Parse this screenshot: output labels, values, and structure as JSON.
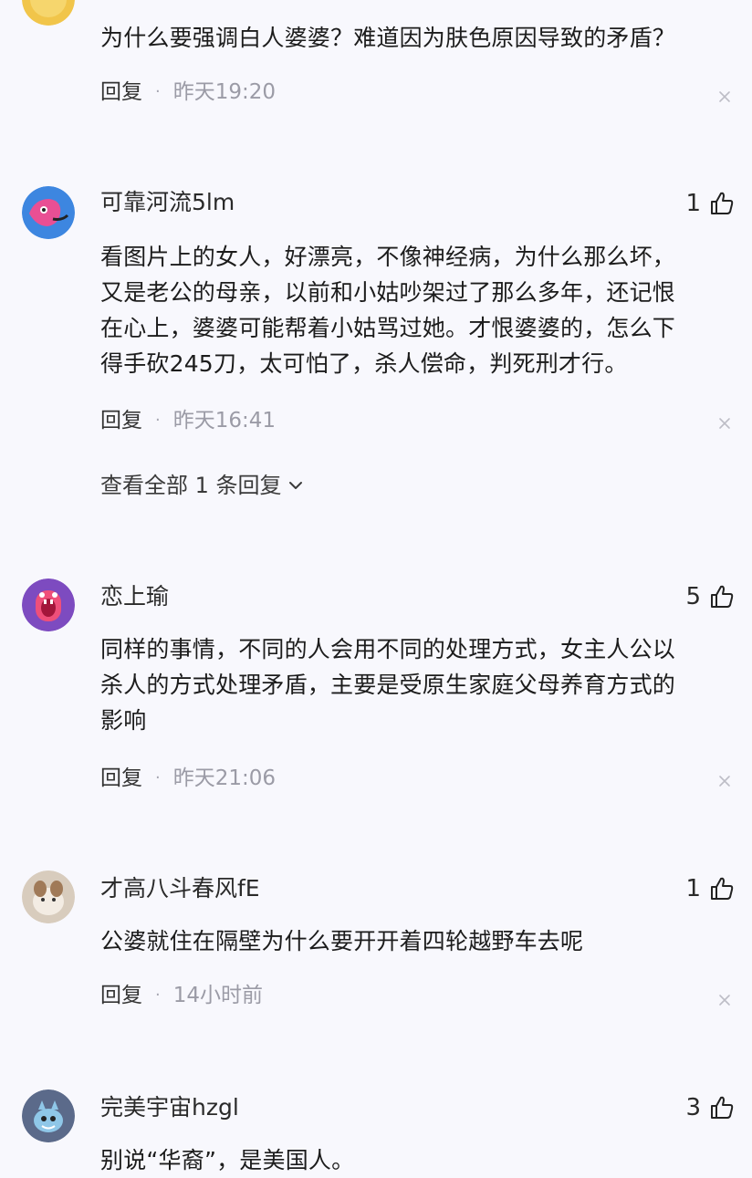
{
  "comments": [
    {
      "name": "",
      "likes": "",
      "text": "为什么要强调白人婆婆？难道因为肤色原因导致的矛盾？",
      "reply": "回复",
      "sep": "·",
      "time": "昨天19:20"
    },
    {
      "name": "可靠河流5lm",
      "likes": "1",
      "text": "看图片上的女人，好漂亮，不像神经病，为什么那么坏，\n又是老公的母亲，以前和小姑吵架过了那么多年，还记恨\n在心上，婆婆可能帮着小姑骂过她。才恨婆婆的，怎么下\n得手砍245刀，太可怕了，杀人偿命，判死刑才行。",
      "reply": "回复",
      "sep": "·",
      "time": "昨天16:41",
      "more": "查看全部 1 条回复"
    },
    {
      "name": "恋上瑜",
      "likes": "5",
      "text": "同样的事情，不同的人会用不同的处理方式，女主人公以\n杀人的方式处理矛盾，主要是受原生家庭父母养育方式的\n影响",
      "reply": "回复",
      "sep": "·",
      "time": "昨天21:06"
    },
    {
      "name": "才高八斗春风fE",
      "likes": "1",
      "text": "公婆就住在隔壁为什么要开开着四轮越野车去呢",
      "reply": "回复",
      "sep": "·",
      "time": "14小时前"
    },
    {
      "name": "完美宇宙hzgl",
      "likes": "3",
      "text": "别说“华裔”，是美国人。"
    }
  ],
  "icons": {
    "like": "thumbs-up-icon",
    "close": "close-icon",
    "expand": "chevron-down-icon"
  },
  "colors": {
    "background": "#f8f8fd",
    "text": "#1c1c1c",
    "meta": "#9b9ba6"
  }
}
